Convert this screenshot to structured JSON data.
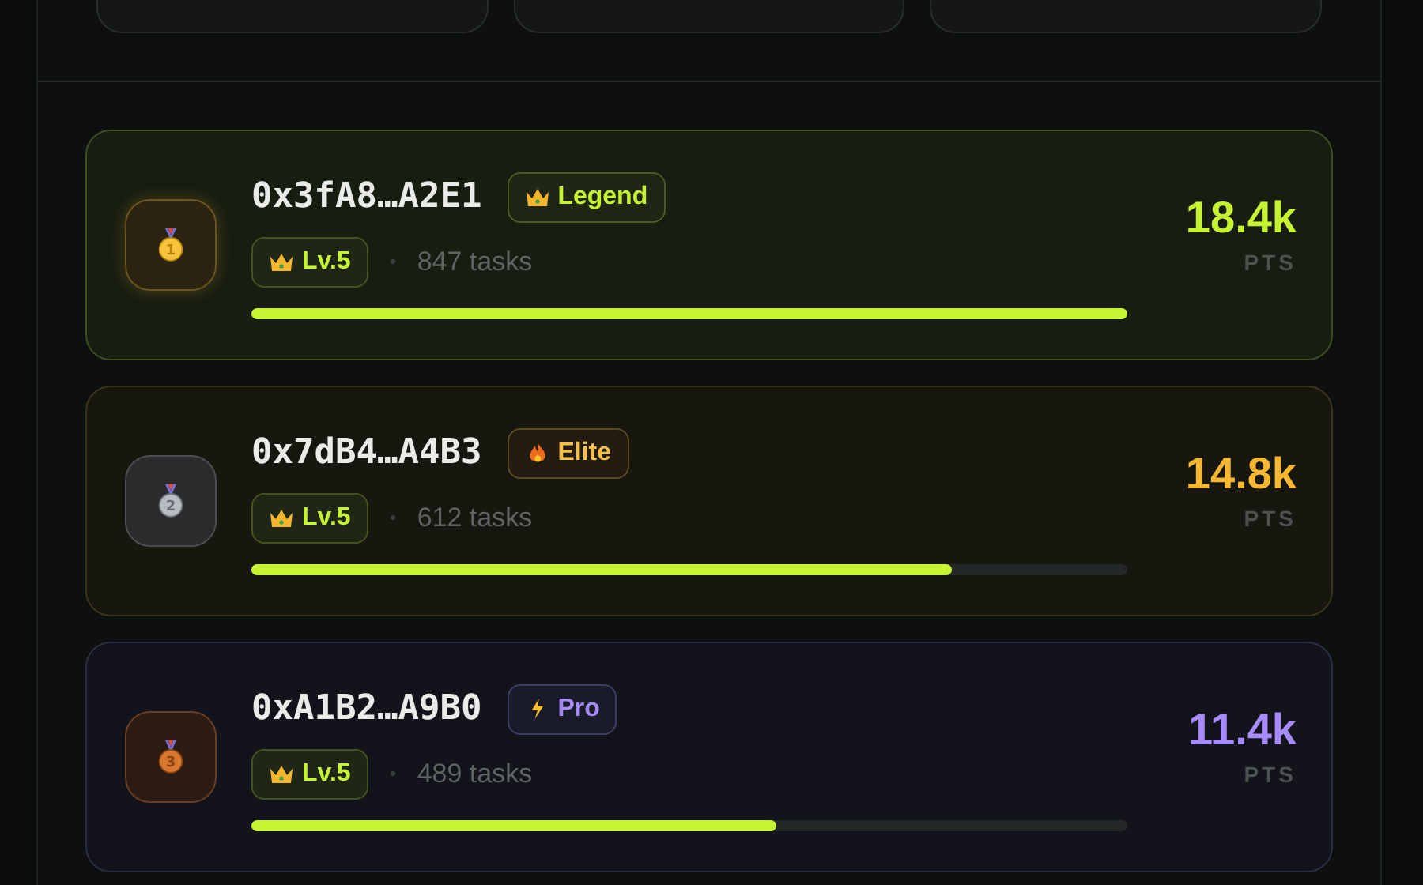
{
  "stat_cards": [
    {
      "kind": "card"
    },
    {
      "kind": "card"
    },
    {
      "kind": "card"
    }
  ],
  "leaderboard": [
    {
      "medal": {
        "kind": "gold",
        "rank": "1"
      },
      "address": "0x3fA8…A2E1",
      "tier": {
        "kind": "legend",
        "label": "Legend"
      },
      "level_badge": "Lv.5",
      "tasks": "847 tasks",
      "level": 1.0,
      "score": "18.4k",
      "unit": "PTS"
    },
    {
      "medal": {
        "kind": "silver",
        "rank": "2"
      },
      "address": "0x7dB4…A4B3",
      "tier": {
        "kind": "elite",
        "label": "Elite"
      },
      "level_badge": "Lv.5",
      "tasks": "612 tasks",
      "level": 0.8,
      "score": "14.8k",
      "unit": "PTS"
    },
    {
      "medal": {
        "kind": "bronze",
        "rank": "3"
      },
      "address": "0xA1B2…A9B0",
      "tier": {
        "kind": "pro",
        "label": "Pro"
      },
      "level_badge": "Lv.5",
      "tasks": "489 tasks",
      "level": 0.6,
      "score": "11.4k",
      "unit": "PTS"
    }
  ]
}
